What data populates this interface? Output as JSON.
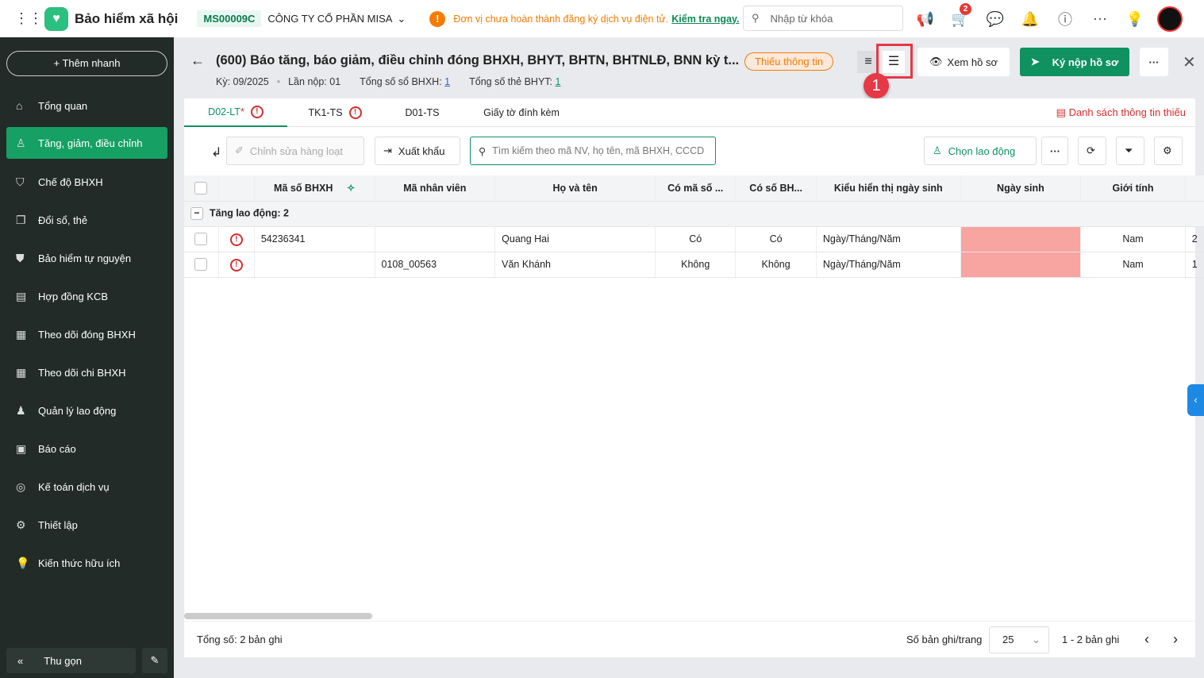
{
  "topbar": {
    "app_title": "Bảo hiểm xã hội",
    "unit_code": "MS00009C",
    "company": "CÔNG TY CỔ PHẦN MISA",
    "warning": "Đơn vị chưa hoàn thành đăng ký dịch vụ điện tử.",
    "warning_link": "Kiểm tra ngay.",
    "search_placeholder": "Nhập từ khóa",
    "cart_badge": "2"
  },
  "sidebar": {
    "quick_add": "Thêm nhanh",
    "items": [
      {
        "label": "Tổng quan"
      },
      {
        "label": "Tăng, giảm, điều chỉnh"
      },
      {
        "label": "Chế độ BHXH"
      },
      {
        "label": "Đổi sổ, thẻ"
      },
      {
        "label": "Bảo hiểm tự nguyện"
      },
      {
        "label": "Hợp đồng KCB"
      },
      {
        "label": "Theo dõi đóng BHXH"
      },
      {
        "label": "Theo dõi chi BHXH"
      },
      {
        "label": "Quản lý lao động"
      },
      {
        "label": "Báo cáo"
      },
      {
        "label": "Kế toán dịch vụ"
      },
      {
        "label": "Thiết lập"
      },
      {
        "label": "Kiến thức hữu ích"
      }
    ],
    "collapse": "Thu gọn"
  },
  "header": {
    "title": "(600) Báo tăng, báo giảm, điều chỉnh đóng BHXH, BHYT, BHTN, BHTNLĐ, BNN kỳ t...",
    "period": "Kỳ: 09/2025",
    "submission": "Lần nộp: 01",
    "total_bhxh_label": "Tổng số sổ BHXH:",
    "total_bhxh": "1",
    "total_bhyt_label": "Tổng số thẻ BHYT:",
    "total_bhyt": "1",
    "status": "Thiếu thông tin",
    "view": "Xem hồ sơ",
    "submit": "Ký nộp hồ sơ",
    "step": "1"
  },
  "tabs": [
    {
      "label": "D02-LT",
      "star": "*"
    },
    {
      "label": "TK1-TS"
    },
    {
      "label": "D01-TS"
    },
    {
      "label": "Giấy tờ đính kèm"
    }
  ],
  "missing_list": "Danh sách thông tin thiếu",
  "toolbar": {
    "bulk_edit": "Chỉnh sửa hàng loạt",
    "export": "Xuất khẩu",
    "search_placeholder": "Tìm kiếm theo mã NV, họ tên, mã BHXH, CCCD",
    "choose": "Chọn lao động"
  },
  "table": {
    "columns": [
      "Mã số BHXH",
      "Mã nhân viên",
      "Họ và tên",
      "Có mã số ...",
      "Có số BH...",
      "Kiểu hiển thị ngày sinh",
      "Ngày sinh",
      "Giới tính"
    ],
    "group": "Tăng lao động: 2",
    "rows": [
      {
        "bhxh": "54236341",
        "emp": "",
        "name": "Quang Hai",
        "c1": "Có",
        "c2": "Có",
        "dob_type": "Ngày/Tháng/Năm",
        "dob": "",
        "gender": "Nam",
        "next": "2"
      },
      {
        "bhxh": "",
        "emp": "0108_00563",
        "name": "Văn Khánh",
        "c1": "Không",
        "c2": "Không",
        "dob_type": "Ngày/Tháng/Năm",
        "dob": "",
        "gender": "Nam",
        "next": "1"
      }
    ]
  },
  "footer": {
    "total": "Tổng số: 2 bản ghi",
    "per_page_label": "Số bản ghi/trang",
    "per_page": "25",
    "range": "1 - 2 bản ghi"
  }
}
